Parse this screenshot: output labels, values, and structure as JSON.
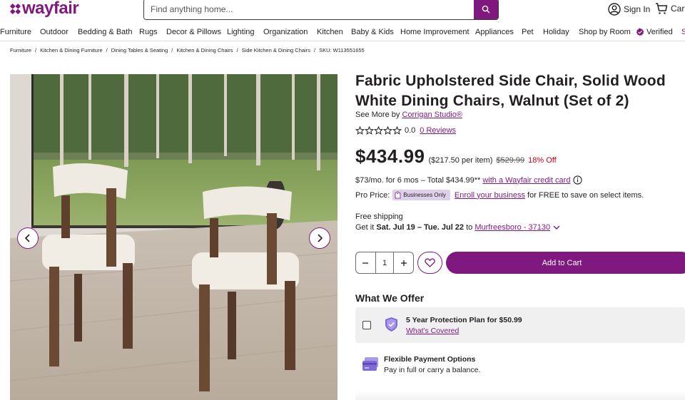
{
  "header": {
    "logo_text": "wayfair",
    "search_placeholder": "Find anything home...",
    "sign_in": "Sign In",
    "cart": "Cart"
  },
  "nav": {
    "items": [
      "Furniture",
      "Outdoor",
      "Bedding & Bath",
      "Rugs",
      "Decor & Pillows",
      "Lighting",
      "Organization",
      "Kitchen",
      "Baby & Kids",
      "Home Improvement",
      "Appliances",
      "Pet",
      "Holiday",
      "Shop by Room",
      "Verified",
      "S"
    ]
  },
  "breadcrumb": {
    "items": [
      "Furniture",
      "Kitchen & Dining Furniture",
      "Dining Tables & Seating",
      "Kitchen & Dining Chairs",
      "Side Kitchen & Dining Chairs"
    ],
    "sku": "SKU: W113551655"
  },
  "product": {
    "title": "Fabric Upholstered Side Chair, Solid Wood White Dining Chairs, Walnut (Set of 2)",
    "see_more_prefix": "See More by",
    "brand": "Corrigan Studio®",
    "rating": "0.0",
    "reviews": "0 Reviews",
    "price": "$434.99",
    "per_item": "($217.50 per item)",
    "list_price": "$529.99",
    "discount": "18% Off",
    "financing": "$73/mo. for 6 mos – Total $434.99**",
    "financing_link": "with a Wayfair credit card",
    "pro_label": "Pro Price:",
    "pro_badge": "Businesses Only",
    "pro_link": "Enroll your business",
    "pro_suffix": "for FREE to save on select items.",
    "shipping_label": "Free shipping",
    "get_it": "Get it",
    "delivery_dates": "Sat. Jul 19 – Tue. Jul 22",
    "to": "to",
    "location": "Murfreesboro - 37130",
    "quantity": "1",
    "add_to_cart": "Add to Cart"
  },
  "offer": {
    "heading": "What We Offer",
    "protection_title": "5 Year Protection Plan for $50.99",
    "protection_link": "What's Covered",
    "payment_title": "Flexible Payment Options",
    "payment_sub": "Pay in full or carry a balance."
  },
  "colors": {
    "brand": "#7f187f",
    "discount": "#c7001e"
  }
}
